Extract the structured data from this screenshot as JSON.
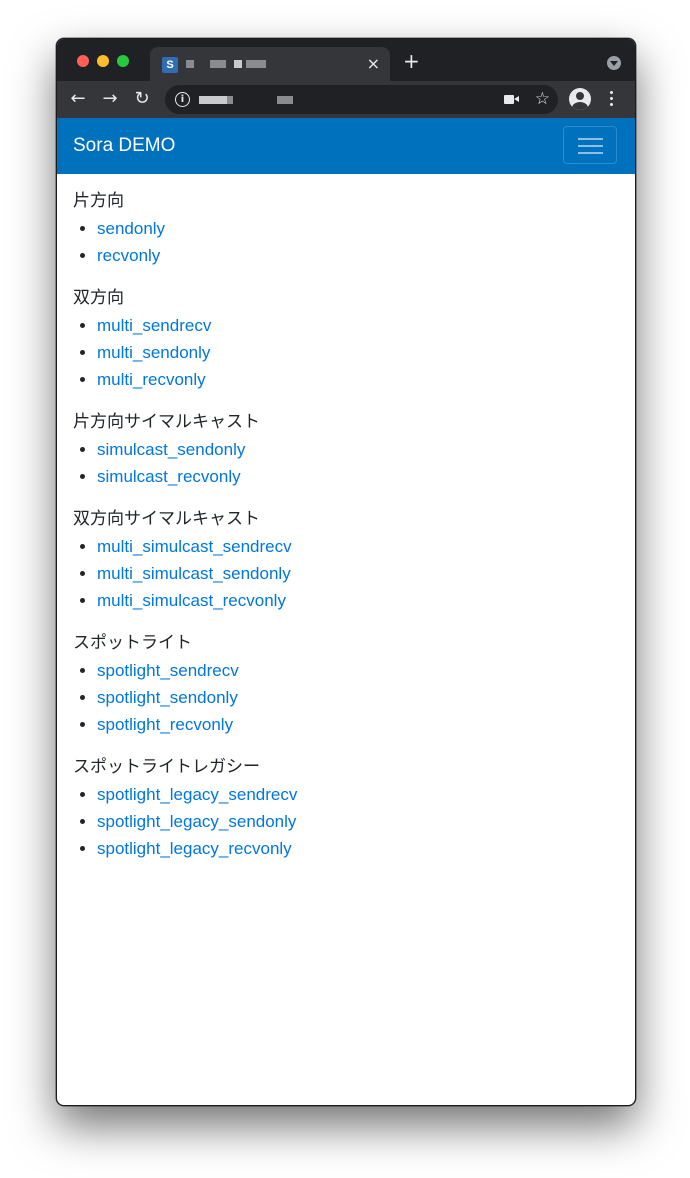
{
  "browser": {
    "tab": {
      "favicon_letter": "S",
      "close_icon": "×"
    },
    "new_tab_icon": "+",
    "toolbar": {
      "back_icon": "←",
      "forward_icon": "→",
      "reload_icon": "↻",
      "info_icon": "i",
      "star_icon": "☆"
    }
  },
  "navbar": {
    "brand": "Sora DEMO",
    "color": "#0071bc"
  },
  "sections": [
    {
      "title": "片方向",
      "links": [
        "sendonly",
        "recvonly"
      ]
    },
    {
      "title": "双方向",
      "links": [
        "multi_sendrecv",
        "multi_sendonly",
        "multi_recvonly"
      ]
    },
    {
      "title": "片方向サイマルキャスト",
      "links": [
        "simulcast_sendonly",
        "simulcast_recvonly"
      ]
    },
    {
      "title": "双方向サイマルキャスト",
      "links": [
        "multi_simulcast_sendrecv",
        "multi_simulcast_sendonly",
        "multi_simulcast_recvonly"
      ]
    },
    {
      "title": "スポットライト",
      "links": [
        "spotlight_sendrecv",
        "spotlight_sendonly",
        "spotlight_recvonly"
      ]
    },
    {
      "title": "スポットライトレガシー",
      "links": [
        "spotlight_legacy_sendrecv",
        "spotlight_legacy_sendonly",
        "spotlight_legacy_recvonly"
      ]
    }
  ],
  "colors": {
    "link": "#0077e0",
    "text": "#212529"
  }
}
